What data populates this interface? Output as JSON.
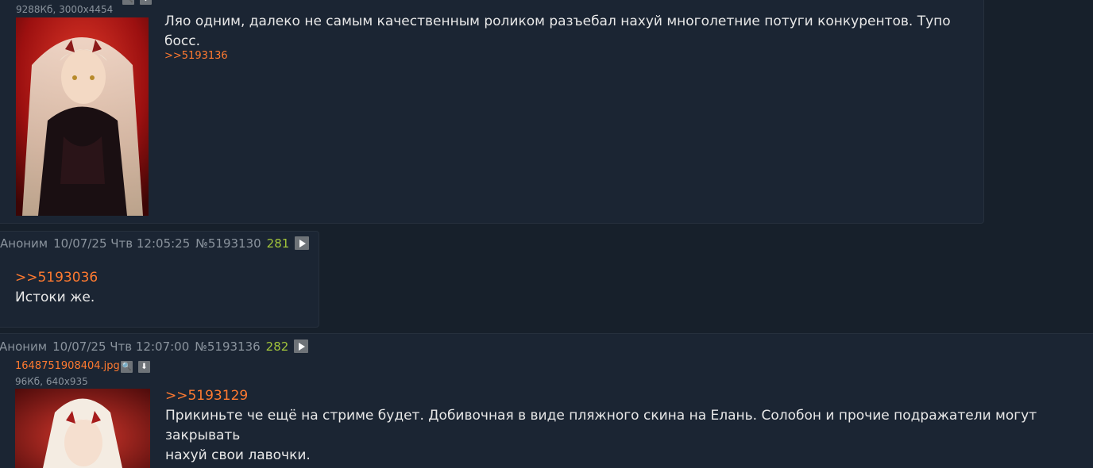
{
  "posts": [
    {
      "file_info": "9288Кб, 3000x4454",
      "text": "Ляо одним, далеко не самым качественным роликом разъебал нахуй многолетние потуги конкурентов. Тупо босс.",
      "backlink": ">>5193136"
    },
    {
      "author": "Аноним",
      "date": "10/07/25 Чтв 12:05:25",
      "number": "№5193130",
      "count": "281",
      "reply_ref": ">>5193036",
      "text": "Истоки же."
    },
    {
      "author": "Аноним",
      "date": "10/07/25 Чтв 12:07:00",
      "number": "№5193136",
      "count": "282",
      "file_name": "1648751908404.jpg",
      "file_info": "96Кб, 640x935",
      "reply_ref": ">>5193129",
      "text_line1": "Прикиньте че ещё на стриме будет. Добивочная в виде пляжного скина на Елань. Солобон и прочие подражатели могут закрывать",
      "text_line2": "нахуй свои лавочки."
    }
  ],
  "icons": {
    "search": "magnifier-icon",
    "download": "download-icon",
    "play": "play-icon"
  },
  "colors": {
    "background": "#17202b",
    "post_bg": "#1b2533",
    "link": "#ff7a30",
    "count": "#a2c43b",
    "meta": "#8a939d"
  }
}
